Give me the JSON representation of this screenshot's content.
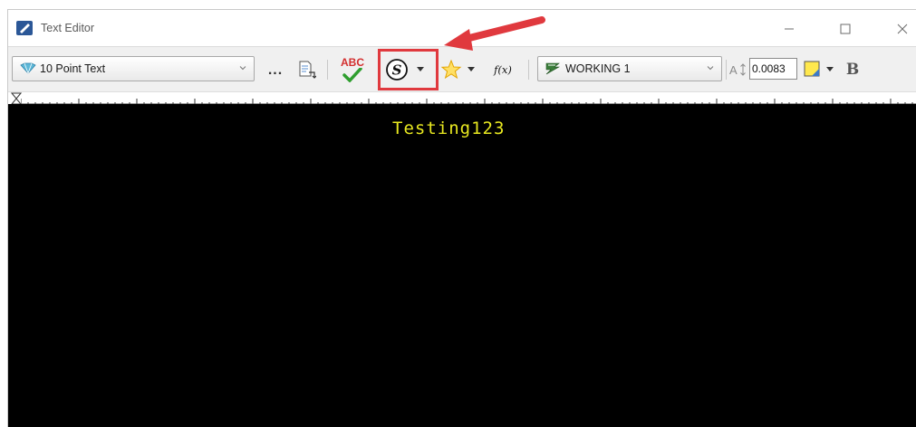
{
  "window": {
    "title": "Text Editor",
    "controls": {
      "minimize_icon": "minimize-icon",
      "maximize_icon": "maximize-icon",
      "close_icon": "close-icon"
    }
  },
  "toolbar": {
    "text_style": {
      "value": "10 Point Text",
      "icon": "text-style-icon"
    },
    "more_button": "...",
    "level": {
      "value": "WORKING 1",
      "icon": "level-icon"
    },
    "text_height": {
      "icon": "text-height-icon",
      "value": "0.0083"
    },
    "bold_button": "B",
    "spell_check_label": "ABC",
    "insert_field_label": "f(x)",
    "highlighted_button": "symbol-insert-button"
  },
  "editor": {
    "content": "Testing123",
    "text_color": "#e8e820",
    "background": "#000000"
  },
  "annotation": {
    "arrow_color": "#e0393e",
    "highlight_color": "#e0393e"
  }
}
